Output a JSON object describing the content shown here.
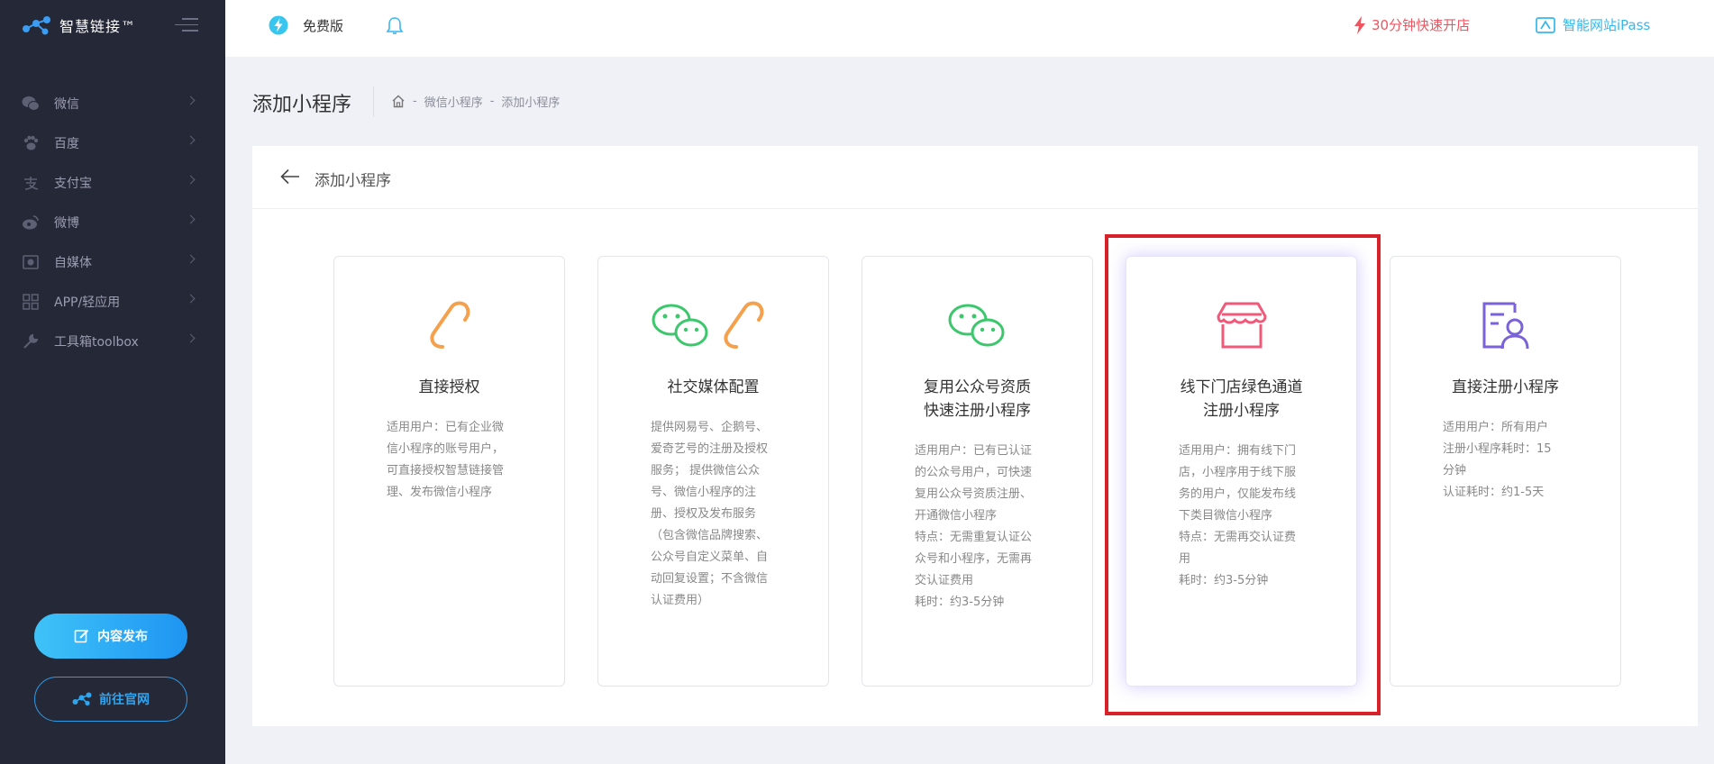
{
  "brand": {
    "name": "智慧链接™"
  },
  "sidebar": {
    "items": [
      {
        "label": "微信",
        "icon": "wechat-icon"
      },
      {
        "label": "百度",
        "icon": "paw-icon"
      },
      {
        "label": "支付宝",
        "icon": "alipay-icon"
      },
      {
        "label": "微博",
        "icon": "weibo-icon"
      },
      {
        "label": "自媒体",
        "icon": "media-icon"
      },
      {
        "label": "APP/轻应用",
        "icon": "app-grid-icon"
      },
      {
        "label": "工具箱toolbox",
        "icon": "wrench-icon"
      }
    ],
    "publish_button": "内容发布",
    "site_button": "前往官网"
  },
  "topbar": {
    "version": "免费版",
    "fast_open": "30分钟快速开店",
    "ipass": "智能网站iPass"
  },
  "page": {
    "title": "添加小程序",
    "breadcrumb": {
      "sep": "-",
      "level1": "微信小程序",
      "level2": "添加小程序"
    }
  },
  "panel": {
    "title": "添加小程序",
    "cards": [
      {
        "title_lines": [
          "直接授权"
        ],
        "desc_lines": [
          "适用用户：已有企业微",
          "信小程序的账号用户，",
          "可直接授权智慧链接管",
          "理、发布微信小程序"
        ]
      },
      {
        "title_lines": [
          "社交媒体配置"
        ],
        "desc_lines": [
          "提供网易号、企鹅号、",
          "爱奇艺号的注册及授权",
          "服务； 提供微信公众",
          "号、微信小程序的注",
          "册、授权及发布服务",
          "（包含微信品牌搜索、",
          "公众号自定义菜单、自",
          "动回复设置；不含微信",
          "认证费用）"
        ]
      },
      {
        "title_lines": [
          "复用公众号资质",
          "快速注册小程序"
        ],
        "desc_lines": [
          "适用用户：已有已认证",
          "的公众号用户，可快速",
          "复用公众号资质注册、",
          "开通微信小程序",
          "特点：无需重复认证公",
          "众号和小程序，无需再",
          "交认证费用",
          "耗时：约3-5分钟"
        ]
      },
      {
        "title_lines": [
          "线下门店绿色通道",
          "注册小程序"
        ],
        "desc_lines": [
          "适用用户：拥有线下门",
          "店，小程序用于线下服",
          "务的用户，仅能发布线",
          "下类目微信小程序",
          "特点：无需再交认证费",
          "用",
          "耗时：约3-5分钟"
        ]
      },
      {
        "title_lines": [
          "直接注册小程序"
        ],
        "desc_lines": [
          "适用用户：所有用户",
          "注册小程序耗时：15",
          "分钟",
          "认证耗时：约1-5天"
        ]
      }
    ]
  },
  "colors": {
    "sidebar_bg": "#252837",
    "accent_blue": "#2fa5ef",
    "accent_red": "#f0545e",
    "orange_icon": "#f4a04c",
    "green_icon": "#3cc76d",
    "pink_icon": "#ef5a7a",
    "purple_icon": "#7a62d8",
    "highlight": "#d8222a"
  }
}
